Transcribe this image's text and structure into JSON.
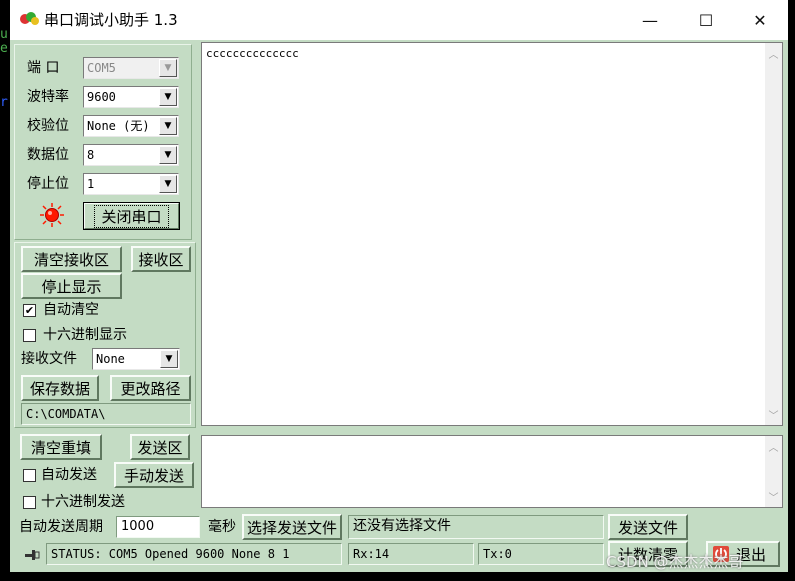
{
  "left_edge": {
    "chars": [
      "u",
      "e",
      "r"
    ]
  },
  "window": {
    "title": "串口调试小助手 1.3",
    "minimize_glyph": "—",
    "maximize_glyph": "☐",
    "close_glyph": "✕"
  },
  "settings": {
    "port_label": "端 口",
    "port_value": "COM5",
    "baud_label": "波特率",
    "baud_value": "9600",
    "parity_label": "校验位",
    "parity_value": "None (无)",
    "databits_label": "数据位",
    "databits_value": "8",
    "stopbits_label": "停止位",
    "stopbits_value": "1",
    "close_port_button": "关闭串口"
  },
  "receive": {
    "clear_button": "清空接收区",
    "area_label": "接收区",
    "stop_display_button": "停止显示",
    "auto_clear_label": "自动清空",
    "auto_clear_checked": true,
    "hex_display_label": "十六进制显示",
    "hex_display_checked": false,
    "file_label": "接收文件",
    "file_value": "None",
    "save_data_button": "保存数据",
    "change_path_button": "更改路径",
    "path_value": "C:\\COMDATA\\",
    "content": "cccccccccccccc"
  },
  "send": {
    "clear_resend_button": "清空重填",
    "area_label": "发送区",
    "auto_send_label": "自动发送",
    "auto_send_checked": false,
    "manual_send_button": "手动发送",
    "hex_send_label": "十六进制发送",
    "hex_send_checked": false,
    "period_label": "自动发送周期",
    "period_value": "1000",
    "ms_label": "毫秒",
    "choose_file_button": "选择发送文件",
    "file_status": "还没有选择文件",
    "send_file_button": "发送文件",
    "count_clear_button": "计数清零",
    "exit_button": "退出"
  },
  "status": {
    "text": "STATUS: COM5 Opened 9600 None  8 1",
    "rx": "Rx:14",
    "tx": "Tx:0"
  },
  "watermark": "CSDN @杰杰杰杰哥",
  "colors": {
    "panel_bg": "#c4dcc4",
    "led_red": "#ff1a00"
  },
  "icons": [
    "app-icon",
    "dropdown-arrow-icon",
    "led-indicator-icon",
    "pin-icon",
    "exit-icon",
    "scroll-up-icon",
    "scroll-down-icon"
  ]
}
